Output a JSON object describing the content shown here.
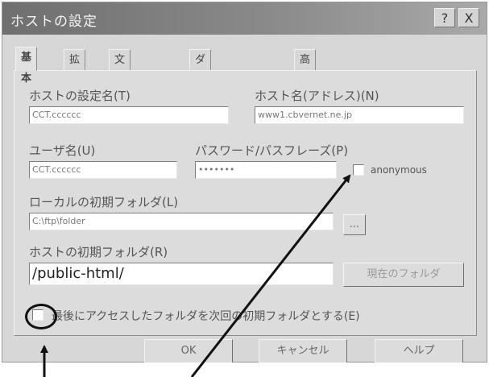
{
  "window": {
    "title": "ホストの設定"
  },
  "title_buttons": {
    "help": "?",
    "close": "X"
  },
  "tabs": [
    "基本",
    "拡張",
    "文字コード",
    "ダイアルアップ",
    "高度"
  ],
  "basic": {
    "host_setting_name": {
      "label": "ホストの設定名(T)",
      "value": "CCT.cccccc"
    },
    "host_name": {
      "label": "ホスト名(アドレス)(N)",
      "value": "www1.cbvernet.ne.jp"
    },
    "username": {
      "label": "ユーザ名(U)",
      "value": "CCT.cccccc"
    },
    "password": {
      "label": "パスワード/パスフレーズ(P)",
      "value": "•••••••"
    },
    "anonymous": {
      "label": "anonymous",
      "checked": false
    },
    "local_initial_folder": {
      "label": "ローカルの初期フォルダ(L)",
      "value": "C:\\ftp\\folder",
      "browse_label": "..."
    },
    "host_initial_folder": {
      "label": "ホストの初期フォルダ(R)",
      "value": "/public-html/",
      "current_folder_label": "現在のフォルダ"
    },
    "last_folder": {
      "label": "最後にアクセスしたフォルダを次回の初期フォルダとする(E)",
      "checked": false
    }
  },
  "buttons": {
    "ok": "OK",
    "cancel": "キャンセル",
    "help": "ヘルプ"
  },
  "colors": {
    "dialog_bg": "#d7d7d7",
    "annotation": "#111111"
  }
}
